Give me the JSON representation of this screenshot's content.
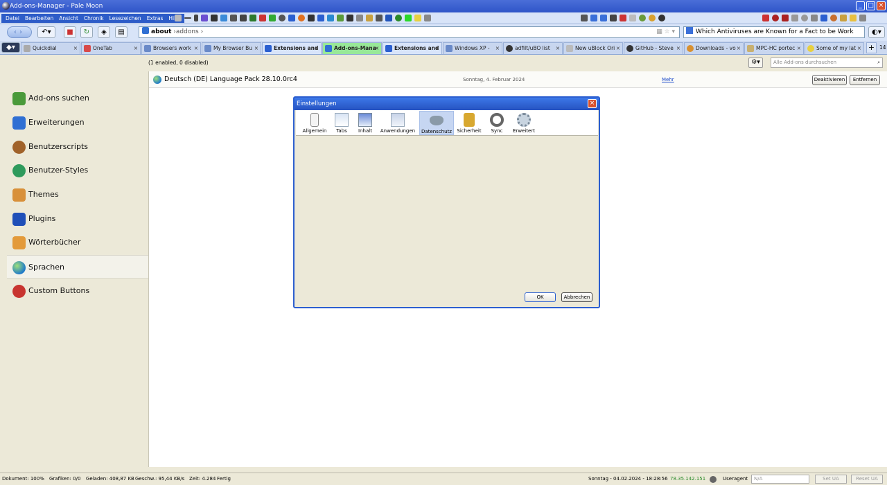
{
  "window": {
    "title": "Add-ons-Manager - Pale Moon"
  },
  "menubar": {
    "items": [
      "Datei",
      "Bearbeiten",
      "Ansicht",
      "Chronik",
      "Lesezeichen",
      "Extras",
      "Hilfe"
    ]
  },
  "navbar": {
    "url_host": "about",
    "url_path": "addons",
    "search_text": "Which Antiviruses are Known for a Fact to be Work"
  },
  "tabs": [
    {
      "label": "Quickdial",
      "icon": "quickdial-icon",
      "state": "normal"
    },
    {
      "label": "OneTab",
      "icon": "onetab-icon",
      "state": "normal"
    },
    {
      "label": "Browsers work",
      "icon": "page-icon",
      "state": "normal"
    },
    {
      "label": "My Browser Bu",
      "icon": "page-icon",
      "state": "normal"
    },
    {
      "label": "Extensions and",
      "icon": "page-icon",
      "state": "selected"
    },
    {
      "label": "Add-ons-Mana",
      "icon": "puzzle-icon",
      "state": "active"
    },
    {
      "label": "Extensions and",
      "icon": "page-icon",
      "state": "selected"
    },
    {
      "label": "Windows XP -",
      "icon": "page-icon",
      "state": "normal"
    },
    {
      "label": "adfilt/uBO list",
      "icon": "github-icon",
      "state": "normal"
    },
    {
      "label": "New uBlock Ori",
      "icon": "page-icon",
      "state": "normal"
    },
    {
      "label": "GitHub - Steve",
      "icon": "github-icon",
      "state": "normal"
    },
    {
      "label": "Downloads - vo",
      "icon": "search-icon",
      "state": "normal"
    },
    {
      "label": "MPC-HC portec",
      "icon": "page-icon",
      "state": "normal"
    },
    {
      "label": "Some of my lat",
      "icon": "bulb-icon",
      "state": "normal"
    }
  ],
  "tab_count": "14",
  "addons": {
    "count_text": "(1 enabled, 0 disabled)",
    "search_placeholder": "Alle Add-ons durchsuchen",
    "categories": [
      {
        "label": "Add-ons suchen",
        "icon": "download-icon",
        "color": "#4a9a3a"
      },
      {
        "label": "Erweiterungen",
        "icon": "puzzle-icon",
        "color": "#2f6fd3"
      },
      {
        "label": "Benutzerscripts",
        "icon": "monkey-icon",
        "color": "#a0622a"
      },
      {
        "label": "Benutzer-Styles",
        "icon": "stylish-icon",
        "color": "#2e9a5c"
      },
      {
        "label": "Themes",
        "icon": "brush-icon",
        "color": "#d8903a"
      },
      {
        "label": "Plugins",
        "icon": "lego-icon",
        "color": "#1f4fb8"
      },
      {
        "label": "Wörterbücher",
        "icon": "book-icon",
        "color": "#e39a3a"
      },
      {
        "label": "Sprachen",
        "icon": "globe-icon",
        "color": "#2e8ad0"
      },
      {
        "label": "Custom Buttons",
        "icon": "custom-buttons-icon",
        "color": "#c8342f"
      }
    ],
    "selected_category": "Sprachen",
    "item": {
      "name": "Deutsch (DE) Language Pack 28.10.0rc4",
      "date": "Sonntag, 4. Februar 2024",
      "more": "Mehr",
      "disable": "Deaktivieren",
      "remove": "Entfernen"
    }
  },
  "dialog": {
    "title": "Einstellungen",
    "panes": [
      {
        "label": "Allgemein",
        "icon": "phone-icon"
      },
      {
        "label": "Tabs",
        "icon": "tabs-icon"
      },
      {
        "label": "Inhalt",
        "icon": "content-icon"
      },
      {
        "label": "Anwendungen",
        "icon": "applications-icon"
      },
      {
        "label": "Datenschutz",
        "icon": "mask-icon"
      },
      {
        "label": "Sicherheit",
        "icon": "lock-icon"
      },
      {
        "label": "Sync",
        "icon": "sync-icon"
      },
      {
        "label": "Erweitert",
        "icon": "gear-icon"
      }
    ],
    "selected_pane": "Datenschutz",
    "ok": "OK",
    "cancel": "Abbrechen"
  },
  "statusbar": {
    "document": "Dokument: 100%",
    "graphics": "Grafiken: 0/0",
    "loaded": "Geladen: 408,87 KB",
    "speed": "Geschw.: 95,44 KB/s",
    "time": "Zeit: 4.284",
    "state": "Fertig",
    "datetime": "Sonntag - 04.02.2024 - 18:28:56",
    "ip": "78.35.142.151",
    "useragent_label": "Useragent",
    "useragent_value": "N/A",
    "set_ua": "Set UA",
    "reset_ua": "Reset UA"
  }
}
